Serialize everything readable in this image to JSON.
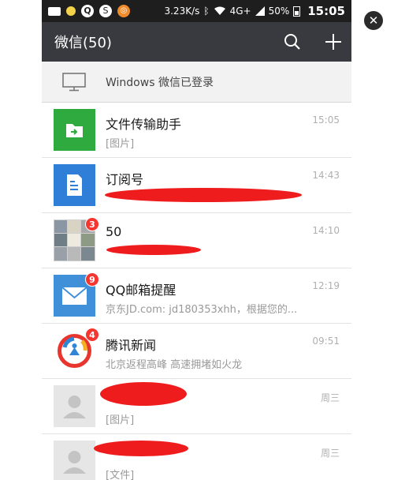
{
  "statusbar": {
    "speed": "3.23K/s",
    "network": "4G+",
    "battery": "50%",
    "time": "15:05"
  },
  "header": {
    "title": "微信(50)",
    "icons": [
      "search-icon",
      "plus-icon"
    ]
  },
  "login_notice": {
    "text": "Windows 微信已登录",
    "icon": "desktop-monitor-icon"
  },
  "chats": [
    {
      "name": "文件传输助手",
      "preview": "[图片]",
      "time": "15:05",
      "badge": "",
      "avatar": "file-transfer-icon",
      "color": "#2eaa3e"
    },
    {
      "name": "订阅号",
      "preview": "",
      "time": "14:43",
      "badge": "",
      "avatar": "subscription-doc-icon",
      "color": "#2f7ed8"
    },
    {
      "name": "50",
      "preview": "",
      "time": "14:10",
      "badge": "3",
      "avatar": "group-collage-avatar",
      "color": "#8a8a8a"
    },
    {
      "name": "QQ邮箱提醒",
      "preview": "京东JD.com: jd180353xhh，根据您的...",
      "time": "12:19",
      "badge": "9",
      "avatar": "mail-envelope-icon",
      "color": "#3f8fd9"
    },
    {
      "name": "腾讯新闻",
      "preview": "北京返程高峰 高速拥堵如火龙",
      "time": "09:51",
      "badge": "4",
      "avatar": "tencent-news-logo",
      "color": "#e8352e"
    },
    {
      "name": "",
      "preview": "[图片]",
      "time": "周三",
      "badge": "",
      "avatar": "default-user-icon",
      "color": "#d8d8d8"
    },
    {
      "name": "",
      "preview": "[文件]",
      "time": "周三",
      "badge": "",
      "avatar": "default-user-icon",
      "color": "#d8d8d8"
    }
  ],
  "overlay": {
    "close_symbol": "✕"
  }
}
